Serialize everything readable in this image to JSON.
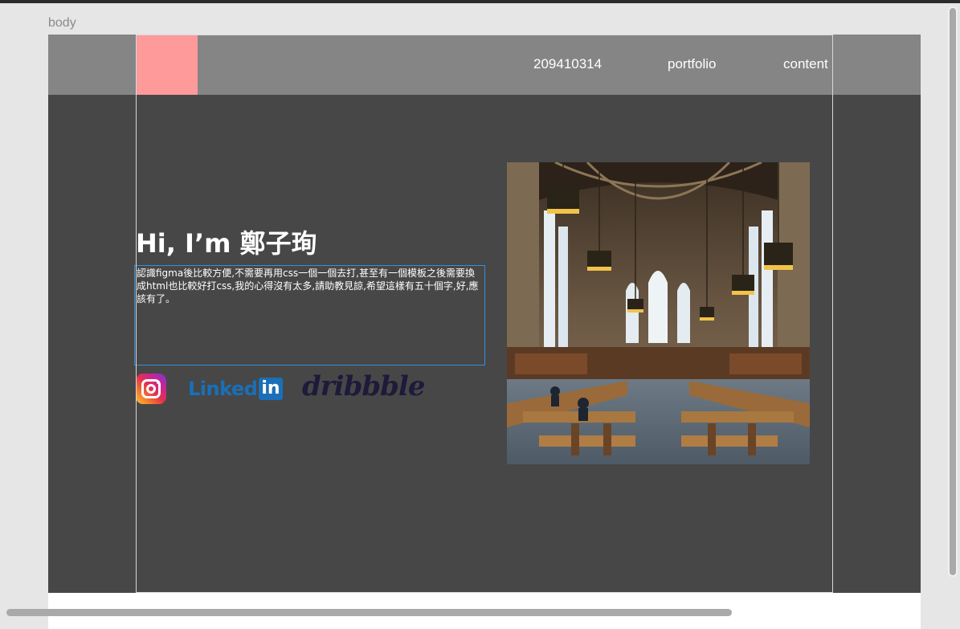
{
  "frame": {
    "label": "body"
  },
  "header": {
    "nav": [
      {
        "label": "209410314"
      },
      {
        "label": "portfolio"
      },
      {
        "label": "content"
      }
    ]
  },
  "hero": {
    "title": "Hi, I’m 鄭子珣",
    "intro": "認識figma後比較方便,不需要再用css一個一個去打,甚至有一個模板之後需要換成html也比較好打css,我的心得沒有太多,請助教見諒,希望這樣有五十個字,好,應該有了。"
  },
  "social": {
    "instagram": {
      "icon": "instagram-icon"
    },
    "linkedin": {
      "text": "Linked",
      "box": "in"
    },
    "dribbble": {
      "text": "dribbble"
    }
  },
  "colors": {
    "stage": "#474747",
    "header": "#858585",
    "logo": "#ff9a9a",
    "selection": "#2f8fe0"
  }
}
